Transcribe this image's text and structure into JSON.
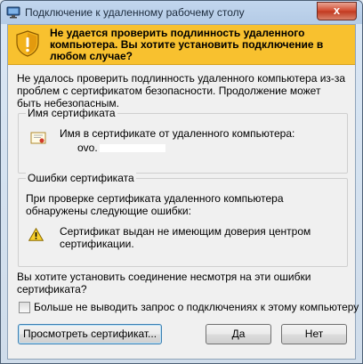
{
  "window": {
    "title": "Подключение к удаленному рабочему столу",
    "close_label": "x"
  },
  "banner": {
    "text": "Не удается проверить подлинность удаленного компьютера. Вы хотите установить подключение в любом случае?"
  },
  "intro": "Не удалось проверить подлинность удаленного компьютера из-за проблем с сертификатом безопасности. Продолжение может быть небезопасным.",
  "certificate_name": {
    "group_title": "Имя сертификата",
    "label": "Имя в сертификате от удаленного компьютера:",
    "value": "ovo."
  },
  "certificate_errors": {
    "group_title": "Ошибки сертификата",
    "intro": "При проверке сертификата удаленного компьютера обнаружены следующие ошибки:",
    "error": "Сертификат выдан не имеющим доверия центром сертификации."
  },
  "question": "Вы хотите установить соединение несмотря на эти ошибки сертификата?",
  "checkbox": {
    "label": "Больше не выводить запрос о подключениях к этому компьютеру",
    "checked": false
  },
  "buttons": {
    "view": "Просмотреть сертификат...",
    "yes": "Да",
    "no": "Нет"
  },
  "colors": {
    "banner": "#f8c12f",
    "dialog_bg": "#f0f0f0",
    "title_bar": "#c2d6ee",
    "close": "#c1391f"
  },
  "icons": {
    "title": "remote-desktop-icon",
    "banner": "security-shield-warning-icon",
    "certificate": "certificate-icon",
    "error": "warning-triangle-icon"
  }
}
